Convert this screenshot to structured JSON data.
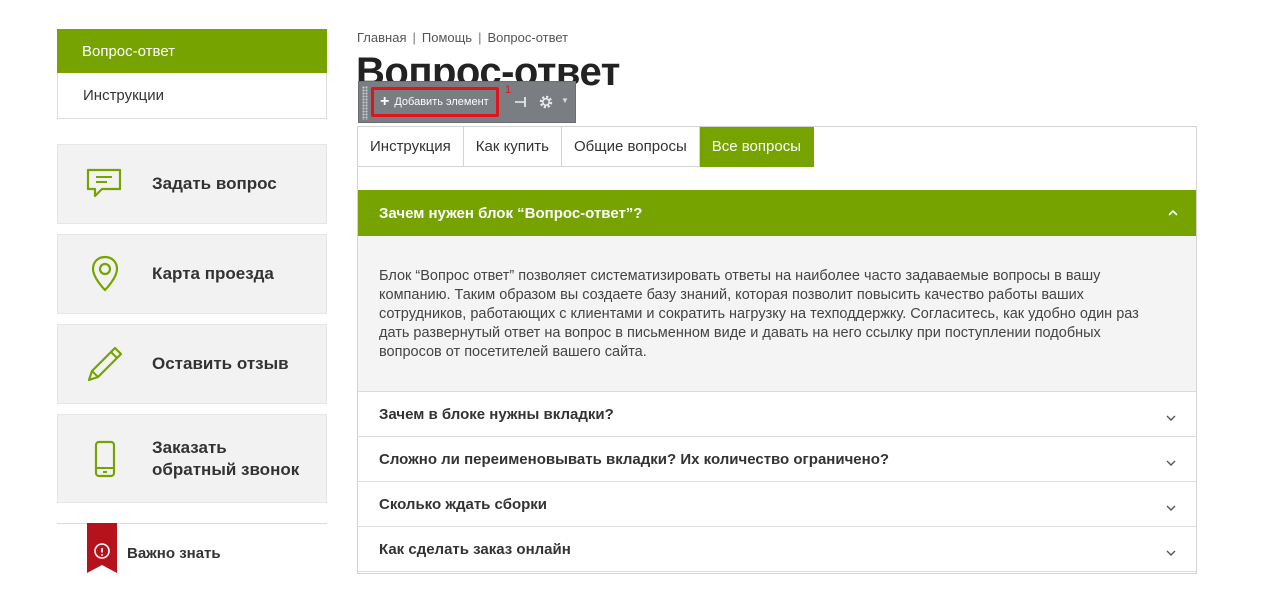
{
  "sidebar": {
    "menu": [
      {
        "label": "Вопрос-ответ",
        "active": true
      },
      {
        "label": "Инструкции",
        "active": false
      }
    ],
    "actions": [
      {
        "label_line1": "Задать вопрос",
        "label_line2": "",
        "icon": "chat-icon"
      },
      {
        "label_line1": "Карта проезда",
        "label_line2": "",
        "icon": "map-pin-icon"
      },
      {
        "label_line1": "Оставить отзыв",
        "label_line2": "",
        "icon": "pencil-icon"
      },
      {
        "label_line1": "Заказать",
        "label_line2": "обратный звонок",
        "icon": "phone-icon"
      }
    ],
    "important": {
      "label": "Важно знать",
      "icon": "info-icon"
    }
  },
  "breadcrumb": [
    "Главная",
    "Помощь",
    "Вопрос-ответ"
  ],
  "breadcrumb_sep": "|",
  "page_title": "Вопрос-ответ",
  "toolbar": {
    "add_label": "Добавить элемент",
    "marker": "1"
  },
  "tabs": [
    {
      "label": "Инструкция",
      "active": false
    },
    {
      "label": "Как купить",
      "active": false
    },
    {
      "label": "Общие вопросы",
      "active": false
    },
    {
      "label": "Все вопросы",
      "active": true
    }
  ],
  "faq": {
    "open_question": "Зачем нужен блок “Вопрос-ответ”?",
    "open_answer": "Блок “Вопрос ответ” позволяет систематизировать ответы на наиболее часто задаваемые вопросы в вашу компанию. Таким образом вы создаете базу знаний, которая позволит повысить качество работы ваших сотрудников, работающих с клиентами и сократить нагрузку на техподдержку. Согласитесь, как удобно один раз дать развернутый ответ на вопрос в письменном виде и давать на него ссылку при поступлении подобных вопросов от посетителей вашего сайта.",
    "questions": [
      "Зачем в блоке нужны вкладки?",
      "Сложно ли переименовывать вкладки? Их количество ограничено?",
      "Сколько ждать сборки",
      "Как сделать заказ онлайн"
    ]
  },
  "colors": {
    "accent": "#76a300",
    "ribbon": "#b5121b",
    "highlight": "#e0141e"
  }
}
